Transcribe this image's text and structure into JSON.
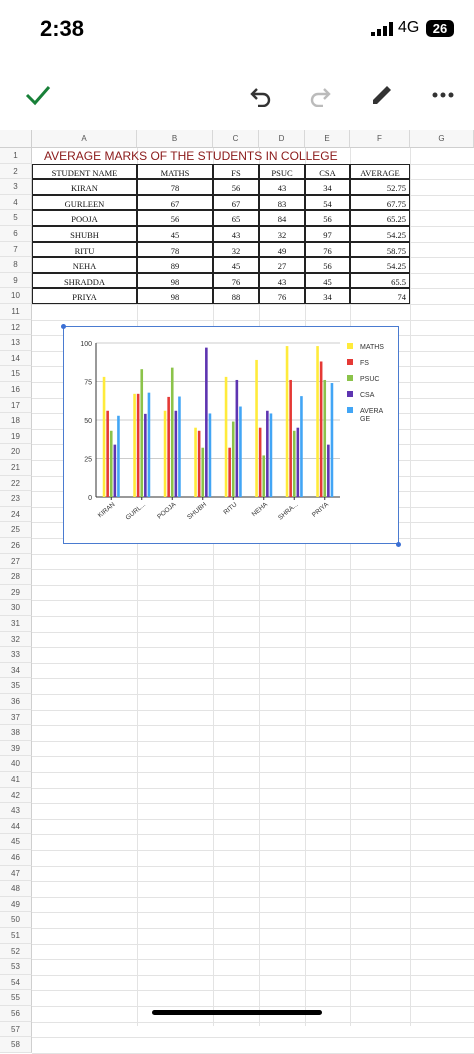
{
  "status": {
    "time": "2:38",
    "network": "4G",
    "battery": "26"
  },
  "toolbar": {
    "confirm": "check-icon",
    "undo": "undo-icon",
    "redo": "redo-icon",
    "edit": "pencil-icon",
    "more": "more-icon"
  },
  "columns": [
    "A",
    "B",
    "C",
    "D",
    "E",
    "F",
    "G"
  ],
  "rows": [
    "1",
    "2",
    "3",
    "4",
    "5",
    "6",
    "7",
    "8",
    "9",
    "10",
    "11",
    "12",
    "13",
    "14",
    "15",
    "16",
    "17",
    "18",
    "19",
    "20",
    "21",
    "22",
    "23",
    "24",
    "25",
    "26",
    "27",
    "28",
    "29",
    "30",
    "31",
    "32",
    "33",
    "34",
    "35",
    "36",
    "37",
    "38",
    "39",
    "40",
    "41",
    "42",
    "43",
    "44",
    "45",
    "46",
    "47",
    "48",
    "49",
    "50",
    "51",
    "52",
    "53",
    "54",
    "55",
    "56",
    "57",
    "58"
  ],
  "sheet_title": "AVERAGE MARKS OF THE STUDENTS IN COLLEGE",
  "table": {
    "headers": [
      "STUDENT NAME",
      "MATHS",
      "FS",
      "PSUC",
      "CSA",
      "AVERAGE"
    ],
    "data": [
      [
        "KIRAN",
        "78",
        "56",
        "43",
        "34",
        "52.75"
      ],
      [
        "GURLEEN",
        "67",
        "67",
        "83",
        "54",
        "67.75"
      ],
      [
        "POOJA",
        "56",
        "65",
        "84",
        "56",
        "65.25"
      ],
      [
        "SHUBH",
        "45",
        "43",
        "32",
        "97",
        "54.25"
      ],
      [
        "RITU",
        "78",
        "32",
        "49",
        "76",
        "58.75"
      ],
      [
        "NEHA",
        "89",
        "45",
        "27",
        "56",
        "54.25"
      ],
      [
        "SHRADDA",
        "98",
        "76",
        "43",
        "45",
        "65.5"
      ],
      [
        "PRIYA",
        "98",
        "88",
        "76",
        "34",
        "74"
      ]
    ]
  },
  "chart_data": {
    "type": "bar",
    "categories": [
      "KIRAN",
      "GURL...",
      "POOJA",
      "SHUBH",
      "RITU",
      "NEHA",
      "SHRA...",
      "PRIYA"
    ],
    "ylim": [
      0,
      100
    ],
    "yticks": [
      "0",
      "25",
      "50",
      "75",
      "100"
    ],
    "legend_position": "right",
    "grid": true,
    "series": [
      {
        "name": "MATHS",
        "color": "#ffeb3b",
        "values": [
          78,
          67,
          56,
          45,
          78,
          89,
          98,
          98
        ]
      },
      {
        "name": "FS",
        "color": "#e53935",
        "values": [
          56,
          67,
          65,
          43,
          32,
          45,
          76,
          88
        ]
      },
      {
        "name": "PSUC",
        "color": "#8bc34a",
        "values": [
          43,
          83,
          84,
          32,
          49,
          27,
          43,
          76
        ]
      },
      {
        "name": "CSA",
        "color": "#5e35b1",
        "values": [
          34,
          54,
          56,
          97,
          76,
          56,
          45,
          34
        ]
      },
      {
        "name": "AVERA GE",
        "color": "#42a5f5",
        "values": [
          52.75,
          67.75,
          65.25,
          54.25,
          58.75,
          54.25,
          65.5,
          74
        ]
      }
    ]
  }
}
